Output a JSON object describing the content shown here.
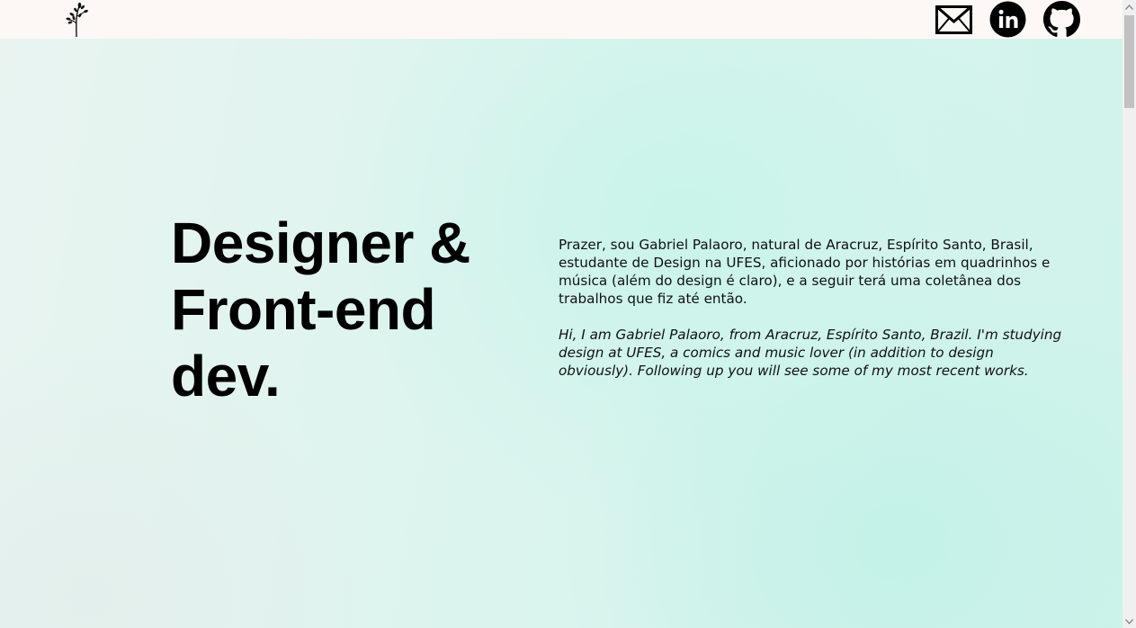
{
  "header": {
    "logo_icon": "plant-sprout-icon",
    "social_links": [
      {
        "name": "email",
        "icon": "envelope-icon"
      },
      {
        "name": "linkedin",
        "icon": "linkedin-icon"
      },
      {
        "name": "github",
        "icon": "github-icon"
      }
    ],
    "background_color": "#fdf8f6"
  },
  "hero": {
    "headline_line1": "Designer &",
    "headline_line2": "Front-end",
    "headline_line3": "dev.",
    "intro_pt": "Prazer, sou Gabriel Palaoro, natural de Aracruz, Espírito Santo, Brasil, estudante de Design na UFES, aficionado por histórias em quadrinhos e música (além do design é claro), e a seguir terá uma coletânea dos trabalhos que fiz até então.",
    "intro_en": "Hi, I am Gabriel Palaoro, from Aracruz, Espírito Santo, Brazil. I'm studying design at UFES, a comics and music lover (in addition to design obviously). Following up you will see some of my most recent works.",
    "background_accent": "#cff3eb"
  }
}
